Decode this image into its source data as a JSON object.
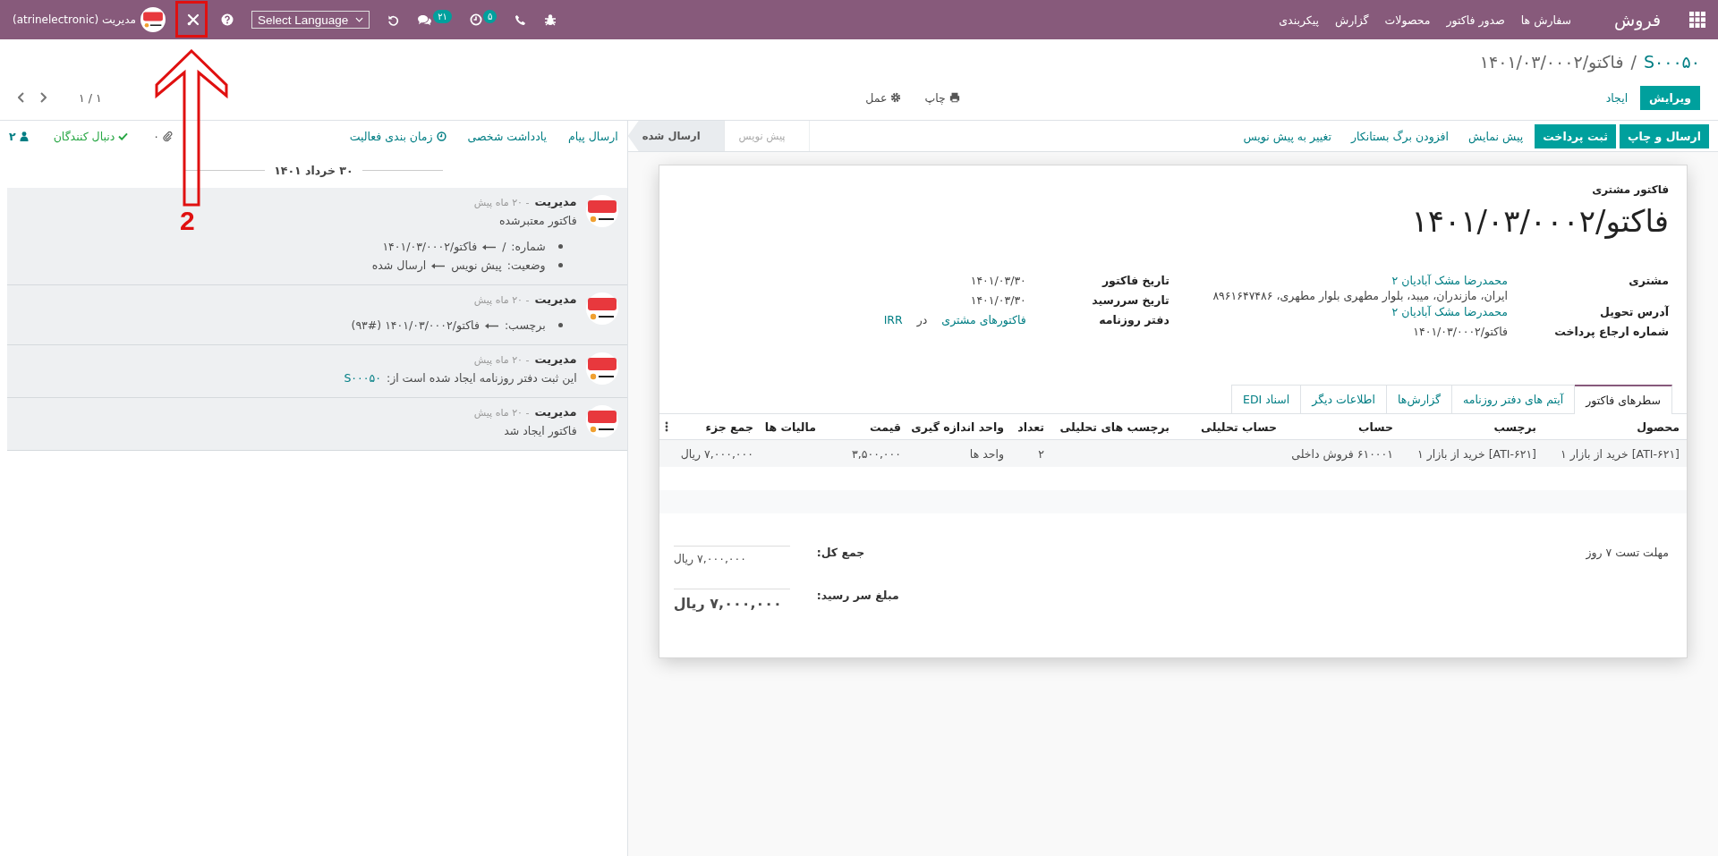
{
  "navbar": {
    "brand": "فروش",
    "menu": [
      "سفارش ها",
      "صدور فاکتور",
      "محصولات",
      "گزارش",
      "پیکربندی"
    ],
    "systray": {
      "activity_count": "۵",
      "message_count": "۲۱",
      "language_placeholder": "Select Language",
      "user": "مدیریت (atrinelectronic)"
    }
  },
  "breadcrumb": {
    "separator": "/",
    "items": [
      {
        "label": "S۰۰۰۵۰",
        "kind": "link"
      },
      {
        "label": "فاکتو/۱۴۰۱/۰۳/۰۰۰۲",
        "kind": "current"
      }
    ]
  },
  "control_buttons": [
    {
      "label": "ویرایش",
      "kind": "primary"
    },
    {
      "label": "ایجاد",
      "kind": "link"
    }
  ],
  "action_menus": [
    {
      "label": "چاپ",
      "kind": "print"
    },
    {
      "label": "عمل",
      "kind": "action"
    }
  ],
  "pager": "۱ / ۱",
  "status_buttons": [
    {
      "label": "ارسال و چاپ",
      "kind": "primary"
    },
    {
      "label": "ثبت پرداخت",
      "kind": "primary"
    },
    {
      "label": "پیش نمایش",
      "kind": "link"
    },
    {
      "label": "افزودن برگ بستانکار",
      "kind": "link"
    },
    {
      "label": "تغییر به پیش نویس",
      "kind": "link"
    }
  ],
  "stages": [
    {
      "label": "پیش نویس",
      "selected": false
    },
    {
      "label": "ارسال شده",
      "selected": true
    }
  ],
  "invoice": {
    "subtitle": "فاکتور مشتری",
    "title": "فاکتو/۱۴۰۱/۰۳/۰۰۰۲",
    "fields_right": [
      {
        "label": "مشتری",
        "value": "محمدرضا مشک آبادیان ۲",
        "link": true,
        "extra": "ایران، مازندران، میبد، بلوار مطهری بلوار مطهری، ۸۹۶۱۶۴۷۴۸۶"
      },
      {
        "label": "آدرس تحویل",
        "value": "محمدرضا مشک آبادیان ۲",
        "link": true
      },
      {
        "label": "شماره ارجاع پرداخت",
        "value": "فاکتو/۱۴۰۱/۰۳/۰۰۰۲",
        "link": false
      }
    ],
    "fields_left": [
      {
        "label": "تاریخ فاکتور",
        "value": "۱۴۰۱/۰۳/۳۰",
        "link": false
      },
      {
        "label": "تاریخ سررسید",
        "value": "۱۴۰۱/۰۳/۳۰",
        "link": false
      },
      {
        "label": "دفتر روزنامه",
        "value": "فاکتورهای مشتری",
        "link": true,
        "joiner": "در",
        "currency": "IRR"
      }
    ],
    "tabs": [
      {
        "label": "سطرهای فاکتور",
        "selected": true
      },
      {
        "label": "آیتم های دفتر روزنامه",
        "selected": false
      },
      {
        "label": "گزارش‌ها",
        "selected": false
      },
      {
        "label": "اطلاعات دیگر",
        "selected": false
      },
      {
        "label": "اسناد EDI",
        "selected": false
      }
    ],
    "table": {
      "columns": [
        "محصول",
        "برچسب",
        "حساب",
        "حساب تحلیلی",
        "برچسب های تحلیلی",
        "تعداد",
        "واحد اندازه گیری",
        "قیمت",
        "مالیات ها",
        "جمع جزء"
      ],
      "rows": [
        [
          "[ATI-۶۲۱] خرید از بازار ۱",
          "[ATI-۶۲۱] خرید از بازار ۱",
          "۶۱۰۰۰۱ فروش داخلی",
          null,
          null,
          "۲",
          "واحد ها",
          "۳,۵۰۰,۰۰۰",
          null,
          "۷,۰۰۰,۰۰۰ ریال"
        ]
      ]
    },
    "note": "مهلت تست ۷ روز",
    "totals": [
      {
        "label": "جمع کل:",
        "value": "۷,۰۰۰,۰۰۰ ریال",
        "kind": "normal"
      },
      {
        "label": "مبلغ سر رسید:",
        "value": "۷,۰۰۰,۰۰۰ ریال",
        "kind": "grand"
      }
    ]
  },
  "chatter": {
    "buttons": [
      {
        "label": "ارسال پیام",
        "kind": "plain"
      },
      {
        "label": "یادداشت شخصی",
        "kind": "plain"
      },
      {
        "label": "زمان بندی فعالیت",
        "kind": "clock"
      }
    ],
    "attachments": "۰",
    "follow_label": "دنبال کنندگان",
    "following": true,
    "followers": "۲",
    "date": "۳۰ خرداد ۱۴۰۱",
    "messages": [
      {
        "author": "مدیریت",
        "time": "- ۲۰ ماه پیش",
        "body": "فاکتور معتبرشده",
        "tracking": [
          {
            "field": "شماره:",
            "old": "/",
            "new": "فاکتو/۱۴۰۱/۰۳/۰۰۰۲"
          },
          {
            "field": "وضعیت:",
            "old": "پیش نویس",
            "new": "ارسال شده"
          }
        ]
      },
      {
        "author": "مدیریت",
        "time": "- ۲۰ ماه پیش",
        "tracking": [
          {
            "field": "برچسب:",
            "new": "فاکتو/۱۴۰۱/۰۳/۰۰۰۲ (#۹۳)"
          }
        ]
      },
      {
        "author": "مدیریت",
        "time": "- ۲۰ ماه پیش",
        "body": "این ثبت دفتر روزنامه ایجاد شده است از:",
        "link": "S۰۰۰۵۰"
      },
      {
        "author": "مدیریت",
        "time": "- ۲۰ ماه پیش",
        "body": "فاکتور ایجاد شد"
      }
    ]
  },
  "annotation": {
    "label": "2"
  }
}
